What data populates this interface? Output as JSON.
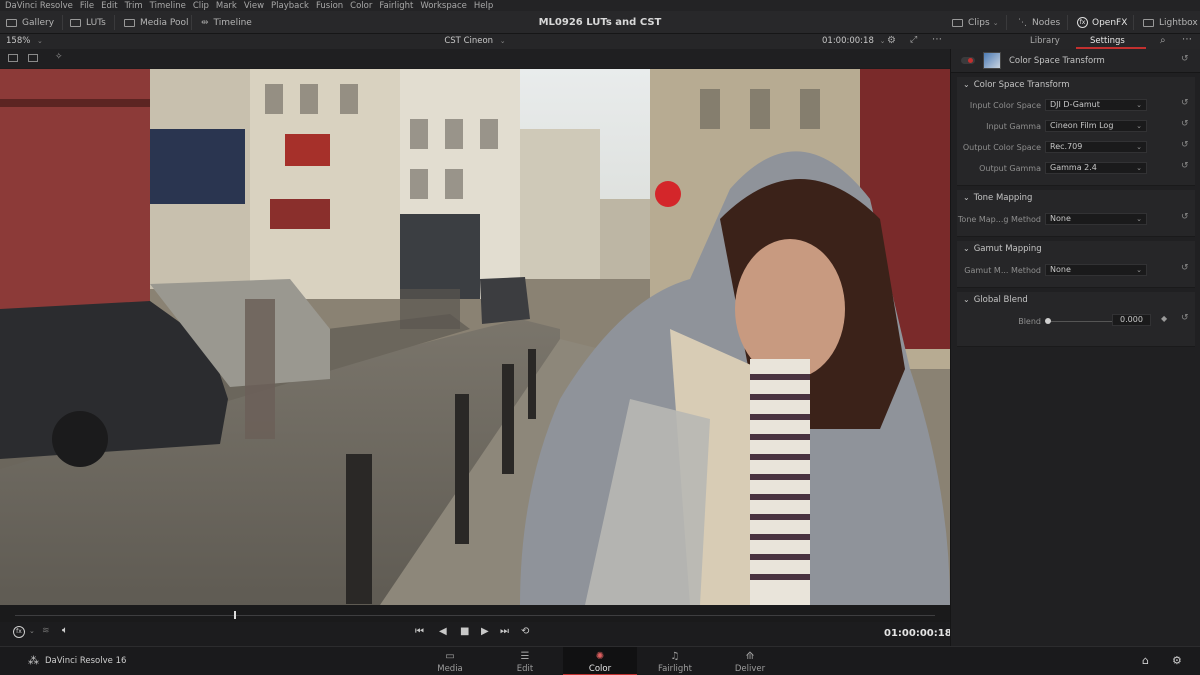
{
  "menubar": {
    "items": [
      "DaVinci Resolve",
      "File",
      "Edit",
      "Trim",
      "Timeline",
      "Clip",
      "Mark",
      "View",
      "Playback",
      "Fusion",
      "Color",
      "Fairlight",
      "Workspace",
      "Help"
    ]
  },
  "toolbar": {
    "gallery": "Gallery",
    "luts": "LUTs",
    "media_pool": "Media Pool",
    "timeline": "Timeline",
    "project_title": "ML0926 LUTs and CST",
    "clips": "Clips",
    "nodes": "Nodes",
    "openfx": "OpenFX",
    "lightbox": "Lightbox"
  },
  "viewer": {
    "zoom": "158%",
    "clip_name": "CST Cineon",
    "timecode": "01:00:00:18"
  },
  "transport": {
    "timecode": "01:00:00:18"
  },
  "panel": {
    "tabs": {
      "library": "Library",
      "settings": "Settings"
    },
    "node_title": "Color Space Transform",
    "cst_section": {
      "title": "Color Space Transform",
      "input_color_space_label": "Input Color Space",
      "input_color_space": "DJI D-Gamut",
      "input_gamma_label": "Input Gamma",
      "input_gamma": "Cineon Film Log",
      "output_color_space_label": "Output Color Space",
      "output_color_space": "Rec.709",
      "output_gamma_label": "Output Gamma",
      "output_gamma": "Gamma 2.4"
    },
    "tone_section": {
      "title": "Tone Mapping",
      "method_label": "Tone Map...g Method",
      "method": "None"
    },
    "gamut_section": {
      "title": "Gamut Mapping",
      "method_label": "Gamut M... Method",
      "method": "None"
    },
    "blend_section": {
      "title": "Global Blend",
      "blend_label": "Blend",
      "blend_value": "0.000"
    }
  },
  "pagebar": {
    "app_name": "DaVinci Resolve 16",
    "pages": {
      "media": "Media",
      "edit": "Edit",
      "color": "Color",
      "fairlight": "Fairlight",
      "deliver": "Deliver"
    },
    "active_page": "color"
  },
  "colors": {
    "accent": "#c2302f",
    "panel_bg": "#202022",
    "toolbar_bg": "#28282a"
  }
}
